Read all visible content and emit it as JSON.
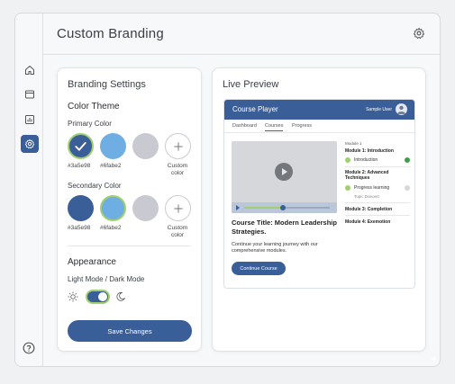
{
  "header": {
    "title": "Custom Branding"
  },
  "sidebar": {
    "items": [
      {
        "icon": "home-icon"
      },
      {
        "icon": "layout-icon"
      },
      {
        "icon": "analytics-icon"
      },
      {
        "icon": "settings-icon",
        "active": true
      }
    ],
    "help_icon": "help-icon"
  },
  "branding": {
    "title": "Branding Settings",
    "color_theme_title": "Color Theme",
    "primary": {
      "label": "Primary Color",
      "swatches": [
        "#3a5e98",
        "#6faee2",
        "#c9c9d2"
      ],
      "hex_labels": [
        "#3a5e98",
        "#6fabe2"
      ],
      "custom_label": "Custom color"
    },
    "secondary": {
      "label": "Secondary Color",
      "swatches": [
        "#3a5e98",
        "#6faee2",
        "#c9c9d2"
      ],
      "hex_labels": [
        "#3a5e98",
        "#6fabe2"
      ],
      "custom_label": "Custom color"
    },
    "appearance_title": "Appearance",
    "mode_label": "Light Mode / Dark Mode",
    "save_label": "Save Changes"
  },
  "preview": {
    "title": "Live Preview",
    "app_title": "Course Player",
    "user": "Sample User",
    "tabs": [
      "Dashboard",
      "Courses",
      "Progress"
    ],
    "course_title": "Course Title: Modern Leadership Strategies.",
    "course_desc": "Continue your learning journey with our comprehensive modules.",
    "continue_label": "Continue Course",
    "video_progress": 0.45,
    "modules": {
      "m1_small": "Module 1",
      "m1_title": "Module 1: Introduction",
      "m1_item": "Introduction",
      "m2_title": "Module 2: Advanced Techniques",
      "m2_item": "Progress learning",
      "m2_sub": "Topic Doeoert",
      "m3_title": "Module 3: Completion",
      "m4_title": "Module 4: Exemotion"
    }
  },
  "colors": {
    "accent": "#3a5e98",
    "light_blue": "#6faee2",
    "green": "#9fd06d",
    "gray": "#c9c9d2"
  }
}
